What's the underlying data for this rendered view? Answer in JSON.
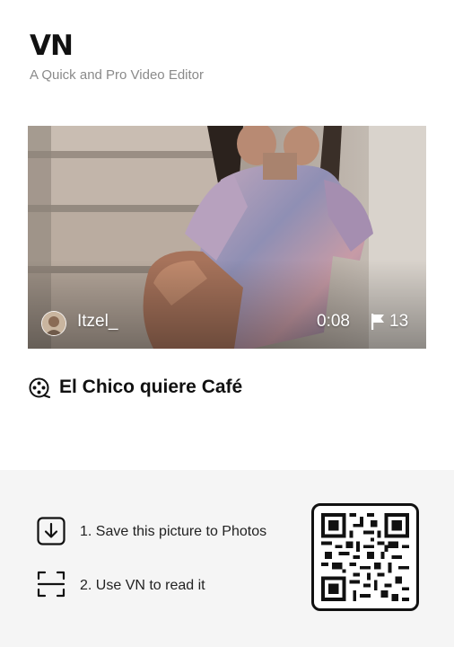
{
  "brand": {
    "logo": "VN",
    "tagline": "A Quick and Pro Video Editor"
  },
  "video": {
    "author": "Itzel_",
    "duration": "0:08",
    "clip_count": "13"
  },
  "song": {
    "title": "El Chico quiere Café"
  },
  "instructions": {
    "step1": "1. Save this picture to Photos",
    "step2": "2. Use VN to read it"
  },
  "icons": {
    "flag": "flag-icon",
    "song": "film-reel-icon",
    "step1": "download-icon",
    "step2": "scan-icon",
    "qr": "qr-code"
  }
}
